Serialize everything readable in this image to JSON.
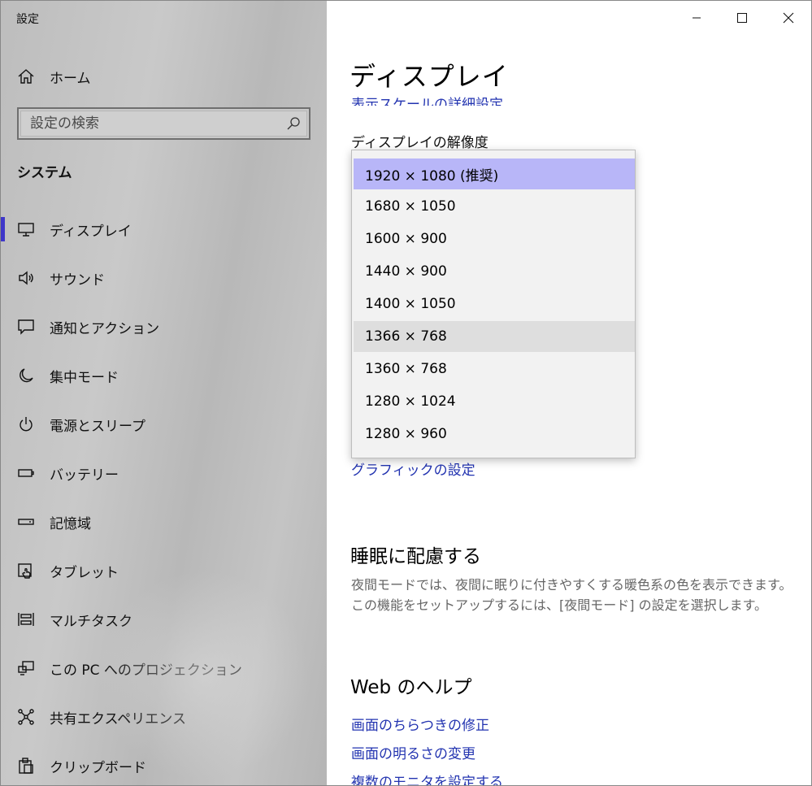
{
  "app": {
    "title": "設定"
  },
  "sidebar": {
    "home_label": "ホーム",
    "search_placeholder": "設定の検索",
    "section_title": "システム",
    "items": [
      {
        "label": "ディスプレイ",
        "icon": "monitor-icon",
        "active": true
      },
      {
        "label": "サウンド",
        "icon": "speaker-icon"
      },
      {
        "label": "通知とアクション",
        "icon": "notification-icon"
      },
      {
        "label": "集中モード",
        "icon": "moon-icon"
      },
      {
        "label": "電源とスリープ",
        "icon": "power-icon"
      },
      {
        "label": "バッテリー",
        "icon": "battery-icon"
      },
      {
        "label": "記憶域",
        "icon": "storage-icon"
      },
      {
        "label": "タブレット",
        "icon": "tablet-icon"
      },
      {
        "label": "マルチタスク",
        "icon": "multitask-icon"
      },
      {
        "label": "この PC へのプロジェクション",
        "icon": "projection-icon"
      },
      {
        "label": "共有エクスペリエンス",
        "icon": "share-icon"
      },
      {
        "label": "クリップボード",
        "icon": "clipboard-icon"
      }
    ]
  },
  "main": {
    "title": "ディスプレイ",
    "cut_link": "表示スケールの詳細設定",
    "resolution_label": "ディスプレイの解像度",
    "resolution_options": [
      "1920 × 1080 (推奨)",
      "1680 × 1050",
      "1600 × 900",
      "1440 × 900",
      "1400 × 1050",
      "1366 × 768",
      "1360 × 768",
      "1280 × 1024",
      "1280 × 960"
    ],
    "selected_option": "1920 × 1080 (推奨)",
    "hovered_option": "1366 × 768",
    "graphics_link": "グラフィックの設定",
    "sleep_heading": "睡眠に配慮する",
    "sleep_desc_line1": "夜間モードでは、夜間に眠りに付きやすくする暖色系の色を表示できます。",
    "sleep_desc_line2": "この機能をセットアップするには、[夜間モード] の設定を選択します。",
    "help_heading": "Web のヘルプ",
    "help_links": [
      "画面のちらつきの修正",
      "画面の明るさの変更",
      "複数のモニタを設定する"
    ]
  },
  "colors": {
    "accent": "#3f37c9",
    "link": "#2233b0",
    "selected": "#b8b6f8"
  }
}
